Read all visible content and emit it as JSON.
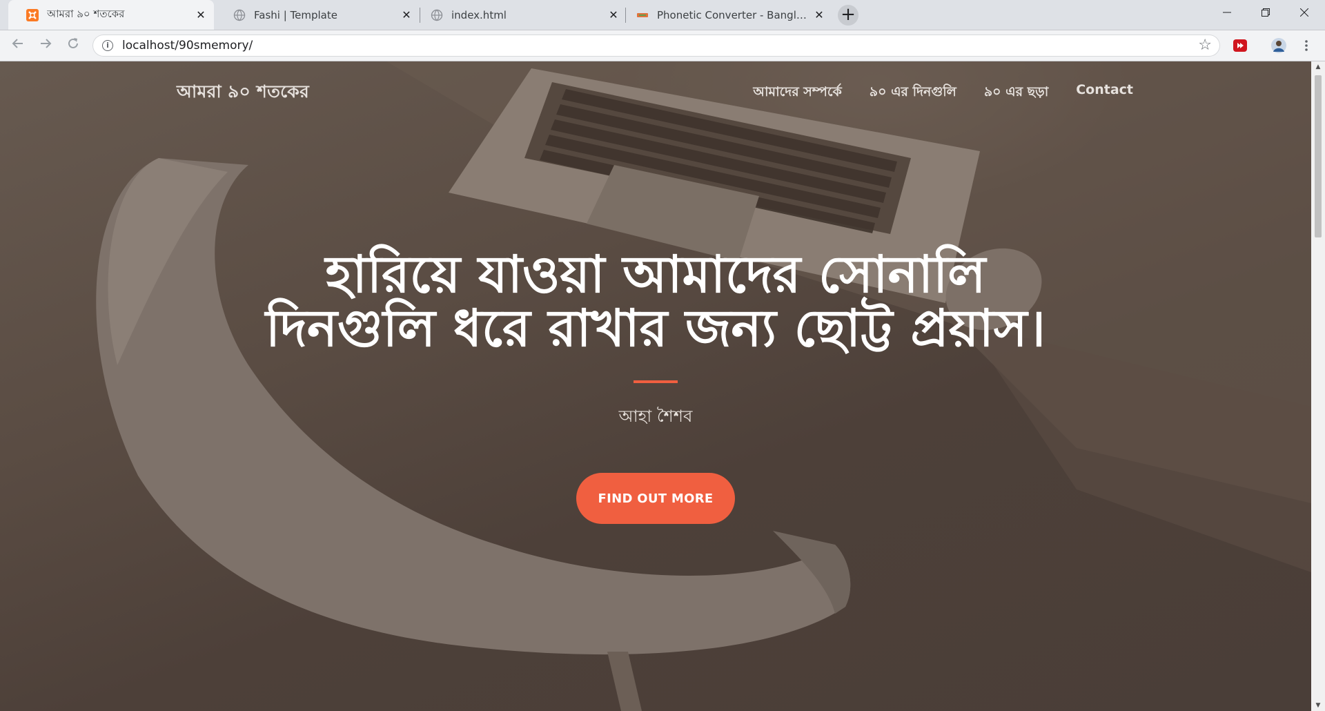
{
  "browser": {
    "tabs": [
      {
        "title": "আমরা ৯০ শতকের",
        "active": true
      },
      {
        "title": "Fashi | Template",
        "active": false
      },
      {
        "title": "index.html",
        "active": false
      },
      {
        "title": "Phonetic Converter - BanglaText",
        "active": false
      }
    ],
    "new_tab_label": "+",
    "url": "localhost/90smemory/"
  },
  "site": {
    "brand": "আমরা ৯০ শতকের",
    "nav": [
      {
        "label": "আমাদের সম্পর্কে"
      },
      {
        "label": "৯০ এর দিনগুলি"
      },
      {
        "label": "৯০ এর ছড়া"
      },
      {
        "label": "Contact"
      }
    ]
  },
  "hero": {
    "headline": "হারিয়ে যাওয়া আমাদের সোনালি দিনগুলি ধরে রাখার জন্য ছোট্ট প্রয়াস।",
    "subtitle": "আহা শৈশব",
    "cta_label": "FIND OUT MORE"
  },
  "colors": {
    "accent": "#f05f40",
    "overlay": "#4d4039",
    "tabstrip": "#dee1e6"
  },
  "icons": [
    "xampp-favicon",
    "globe-favicon",
    "bangla-favicon",
    "back-arrow",
    "forward-arrow",
    "reload",
    "info",
    "star",
    "extension",
    "avatar"
  ]
}
